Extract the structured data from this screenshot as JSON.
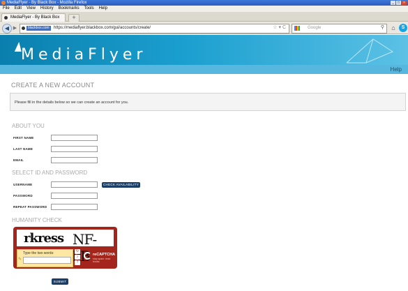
{
  "browser": {
    "window_title": "MediaFlyer - By Black Box - Mozilla Firefox",
    "menu": [
      "File",
      "Edit",
      "View",
      "History",
      "Bookmarks",
      "Tools",
      "Help"
    ],
    "tab_title": "MediaFlyer - By Black Box",
    "new_tab": "+",
    "site_badge": "blackbox.com",
    "url": "https://mediaflyer.blackbox.com/gui/accounts/create/",
    "search_placeholder": "Google",
    "window_buttons": [
      "_",
      "□",
      "×"
    ]
  },
  "site": {
    "logo_text": "MediaFlyer",
    "help_link": "Help"
  },
  "page": {
    "title": "CREATE A NEW ACCOUNT",
    "intro": "Please fill in the details below so we can create an account for you."
  },
  "about": {
    "heading": "ABOUT YOU",
    "first_name_label": "FIRST NAME",
    "last_name_label": "LAST NAME",
    "email_label": "EMAIL"
  },
  "credentials": {
    "heading": "SELECT ID AND PASSWORD",
    "username_label": "USERNAME",
    "check_button": "CHECK AVAILABILITY",
    "password_label": "PASSWORD",
    "repeat_label": "REPEAT PASSWORD"
  },
  "captcha": {
    "heading": "HUMANITY CHECK",
    "word1": "rkress",
    "word2": "NF-kB",
    "prompt": "Type the two words:",
    "brand": "reCAPTCHA",
    "tagline": "stop spam. read books."
  },
  "submit_label": "SUBMIT"
}
